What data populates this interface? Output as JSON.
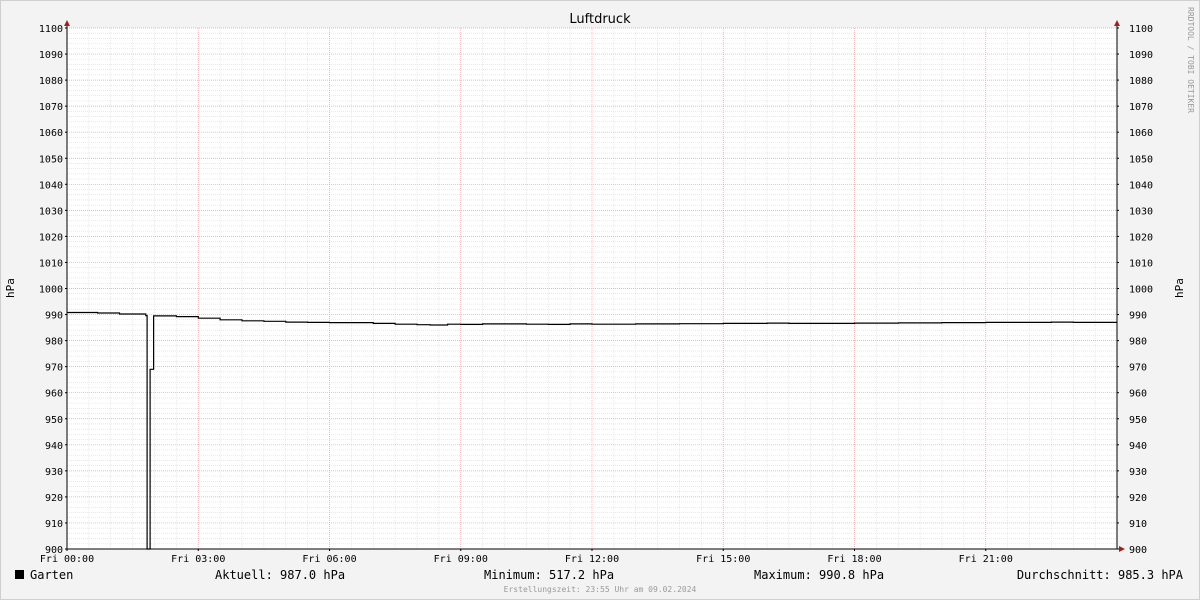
{
  "chart_data": {
    "type": "line",
    "title": "Luftdruck",
    "ylabel": "hPa",
    "ylim": [
      900,
      1100
    ],
    "y_ticks": [
      900,
      910,
      920,
      930,
      940,
      950,
      960,
      970,
      980,
      990,
      1000,
      1010,
      1020,
      1030,
      1040,
      1050,
      1060,
      1070,
      1080,
      1090,
      1100
    ],
    "xlim_hours": [
      0,
      24
    ],
    "x_ticks": [
      {
        "hour": 0,
        "label": "Fri 00:00"
      },
      {
        "hour": 3,
        "label": "Fri 03:00"
      },
      {
        "hour": 6,
        "label": "Fri 06:00"
      },
      {
        "hour": 9,
        "label": "Fri 09:00"
      },
      {
        "hour": 12,
        "label": "Fri 12:00"
      },
      {
        "hour": 15,
        "label": "Fri 15:00"
      },
      {
        "hour": 18,
        "label": "Fri 18:00"
      },
      {
        "hour": 21,
        "label": "Fri 21:00"
      }
    ],
    "grid": true,
    "series": [
      {
        "name": "Garten",
        "color": "#000000",
        "points": [
          [
            0.0,
            990.8
          ],
          [
            0.7,
            990.6
          ],
          [
            1.2,
            990.2
          ],
          [
            1.8,
            989.6
          ],
          [
            1.83,
            517.2
          ],
          [
            1.88,
            517.2
          ],
          [
            1.9,
            969.0
          ],
          [
            1.96,
            969.0
          ],
          [
            1.98,
            989.5
          ],
          [
            2.5,
            989.2
          ],
          [
            3.0,
            988.6
          ],
          [
            3.5,
            988.0
          ],
          [
            4.0,
            987.6
          ],
          [
            4.5,
            987.4
          ],
          [
            5.0,
            987.1
          ],
          [
            5.5,
            987.0
          ],
          [
            6.0,
            986.9
          ],
          [
            7.0,
            986.6
          ],
          [
            7.5,
            986.3
          ],
          [
            8.0,
            986.1
          ],
          [
            8.3,
            986.0
          ],
          [
            8.7,
            986.3
          ],
          [
            9.0,
            986.2
          ],
          [
            9.5,
            986.4
          ],
          [
            10.0,
            986.4
          ],
          [
            10.5,
            986.3
          ],
          [
            11.0,
            986.2
          ],
          [
            11.5,
            986.4
          ],
          [
            12.0,
            986.3
          ],
          [
            12.5,
            986.3
          ],
          [
            13.0,
            986.4
          ],
          [
            14.0,
            986.5
          ],
          [
            15.0,
            986.6
          ],
          [
            16.0,
            986.7
          ],
          [
            16.5,
            986.6
          ],
          [
            17.0,
            986.6
          ],
          [
            18.0,
            986.7
          ],
          [
            19.0,
            986.8
          ],
          [
            20.0,
            986.9
          ],
          [
            21.0,
            987.0
          ],
          [
            22.0,
            987.0
          ],
          [
            22.5,
            987.1
          ],
          [
            23.0,
            987.0
          ],
          [
            23.6,
            987.0
          ],
          [
            24.0,
            987.0
          ]
        ]
      }
    ]
  },
  "watermark": "RRDTOOL / TOBI OETIKER",
  "legend": {
    "series_name": "Garten",
    "current": "Aktuell: 987.0 hPa",
    "minimum": "Minimum: 517.2 hPa",
    "maximum": "Maximum: 990.8 hPa",
    "average": "Durchschnitt: 985.3 hPA"
  },
  "footer": "Erstellungszeit: 23:55 Uhr am 09.02.2024"
}
